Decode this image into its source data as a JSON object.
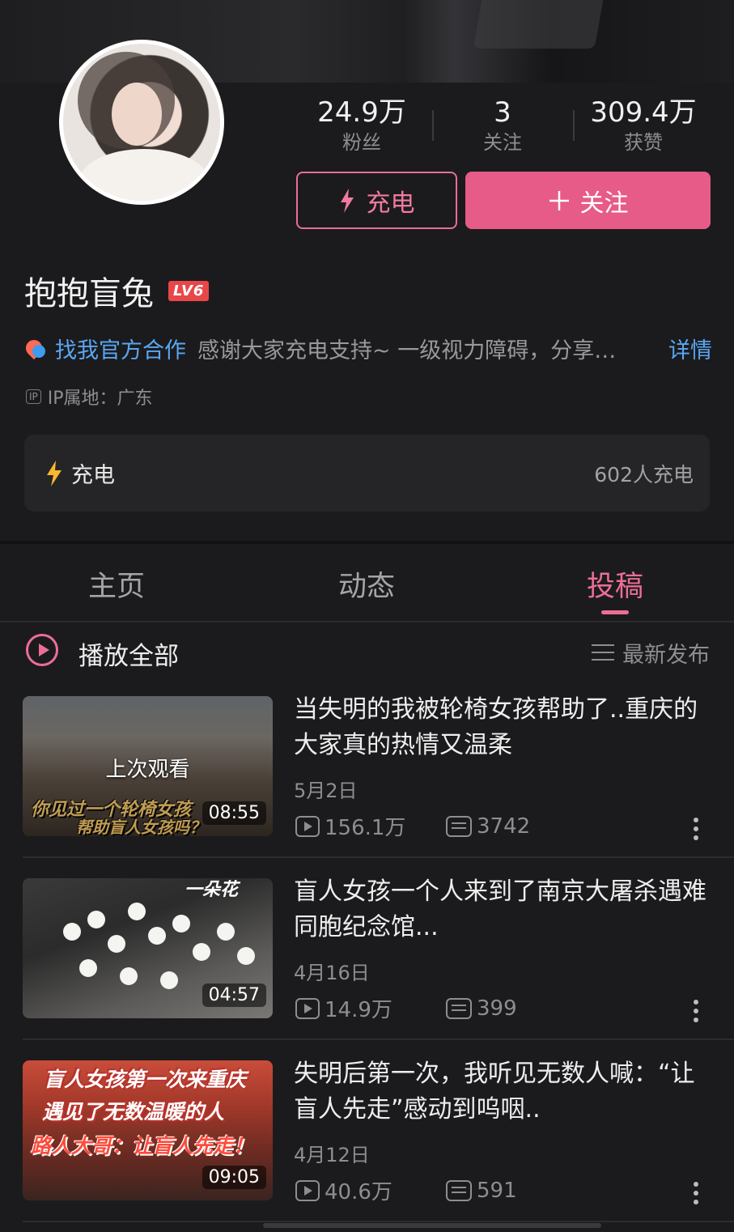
{
  "profile": {
    "name": "抱抱盲兔",
    "level": "LV6",
    "stats": [
      {
        "value": "24.9万",
        "label": "粉丝"
      },
      {
        "value": "3",
        "label": "关注"
      },
      {
        "value": "309.4万",
        "label": "获赞"
      }
    ],
    "charge_button": "充电",
    "follow_button": "关注",
    "cooperation_link": "找我官方合作",
    "bio": "感谢大家充电支持~ 一级视力障碍，分享…",
    "detail_link": "详情",
    "ip_badge": "IP",
    "ip_location": "IP属地：广东"
  },
  "charge_card": {
    "label": "充电",
    "count": "602人充电"
  },
  "tabs": [
    {
      "label": "主页",
      "active": false
    },
    {
      "label": "动态",
      "active": false
    },
    {
      "label": "投稿",
      "active": true
    }
  ],
  "list_header": {
    "play_all": "播放全部",
    "sort": "最新发布"
  },
  "videos": [
    {
      "title": "当失明的我被轮椅女孩帮助了..重庆的大家真的热情又温柔",
      "date": "5月2日",
      "views": "156.1万",
      "danmaku": "3742",
      "duration": "08:55",
      "watched_label": "上次观看",
      "thumb_caption_1": "你见过一个轮椅女孩",
      "thumb_caption_2": "帮助盲人女孩吗？"
    },
    {
      "title": "盲人女孩一个人来到了南京大屠杀遇难同胞纪念馆...",
      "date": "4月16日",
      "views": "14.9万",
      "danmaku": "399",
      "duration": "04:57",
      "thumb_caption_1": "一朵花"
    },
    {
      "title": "失明后第一次，我听见无数人喊：“让盲人先走”感动到呜咽..",
      "date": "4月12日",
      "views": "40.6万",
      "danmaku": "591",
      "duration": "09:05",
      "thumb_caption_1": "盲人女孩第一次来重庆",
      "thumb_caption_2": "遇见了无数温暖的人",
      "thumb_caption_3": "路人大哥：让盲人先走！"
    }
  ],
  "colors": {
    "accent": "#ec6e96",
    "follow_bg": "#e65b88",
    "link": "#5aa6f3",
    "background": "#1b1b1d"
  }
}
